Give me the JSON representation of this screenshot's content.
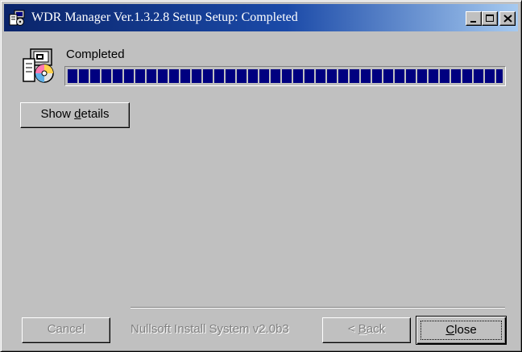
{
  "window": {
    "title": "WDR Manager Ver.1.3.2.8 Setup Setup: Completed",
    "app_icon": "installer-icon",
    "controls": {
      "minimize_icon": "minimize-icon",
      "maximize_icon": "maximize-icon",
      "close_icon": "close-icon"
    }
  },
  "main": {
    "icon": "install-disc-icon",
    "status_text": "Completed",
    "progress": 1.0,
    "show_details": {
      "prefix": "Show ",
      "accel": "d",
      "suffix": "etails"
    }
  },
  "footer": {
    "cancel_label": "Cancel",
    "branding_text": "Nullsoft Install System v2.0b3",
    "back": {
      "prefix": "< ",
      "accel": "B",
      "suffix": "ack"
    },
    "close": {
      "accel": "C",
      "suffix": "lose"
    }
  },
  "colors": {
    "title_gradient_start": "#0a246a",
    "title_gradient_end": "#a6caf0",
    "progress_fill": "#000080",
    "face": "#c0c0c0",
    "disabled_text": "#808080"
  }
}
